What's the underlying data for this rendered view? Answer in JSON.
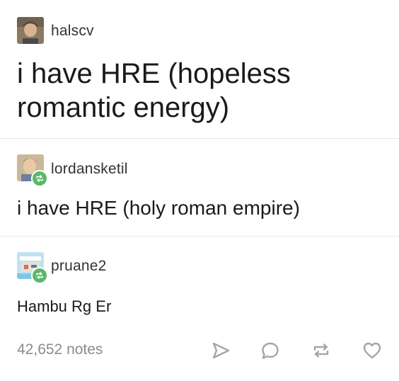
{
  "posts": [
    {
      "username": "halscv",
      "text": "i have HRE (hopeless romantic energy)"
    },
    {
      "username": "lordansketil",
      "text": "i have HRE (holy roman empire)"
    },
    {
      "username": "pruane2",
      "text": "Hambu Rg Er"
    }
  ],
  "footer": {
    "notes": "42,652 notes"
  },
  "icons": {
    "share": "share-icon",
    "reply": "reply-icon",
    "reblog": "reblog-icon",
    "like": "heart-icon"
  },
  "colors": {
    "reblog_badge": "#5ab86a",
    "notes_text": "#8c8c8c",
    "icon_gray": "#a6a6a6"
  }
}
